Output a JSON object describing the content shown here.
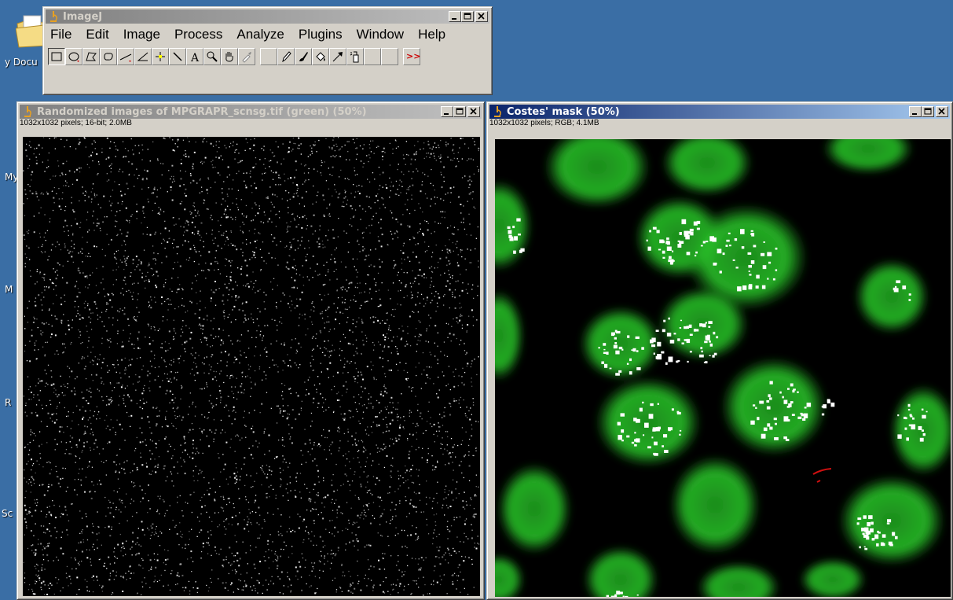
{
  "desktop": {
    "labels": [
      "y Docu",
      "My",
      "M",
      "R",
      "Sc"
    ]
  },
  "imagej": {
    "title": "ImageJ",
    "menu": [
      "File",
      "Edit",
      "Image",
      "Process",
      "Analyze",
      "Plugins",
      "Window",
      "Help"
    ],
    "tools": [
      {
        "name": "rectangle-tool",
        "pressed": true
      },
      {
        "name": "oval-tool"
      },
      {
        "name": "polygon-tool"
      },
      {
        "name": "freehand-tool"
      },
      {
        "name": "line-tool"
      },
      {
        "name": "angle-tool"
      },
      {
        "name": "point-tool"
      },
      {
        "name": "wand-tool"
      },
      {
        "name": "text-tool"
      },
      {
        "name": "magnifier-tool"
      },
      {
        "name": "hand-tool"
      },
      {
        "name": "color-picker-tool"
      },
      {
        "name": "blank-tool"
      },
      {
        "name": "pencil-tool"
      },
      {
        "name": "brush-tool"
      },
      {
        "name": "flood-fill-tool"
      },
      {
        "name": "arrow-tool"
      },
      {
        "name": "spray-tool"
      },
      {
        "name": "blank-tool-2"
      },
      {
        "name": "blank-tool-3"
      },
      {
        "name": "more-tools"
      }
    ],
    "more_label": ">>"
  },
  "window_random": {
    "title": "Randomized images of MPGRAPR_scnsg.tif (green) (50%)",
    "info": "1032x1032 pixels; 16-bit; 2.0MB",
    "active": false
  },
  "window_costes": {
    "title": "Costes' mask (50%)",
    "info": "1032x1032 pixels; RGB; 4.1MB",
    "active": true
  },
  "colors": {
    "desktop": "#3a6ea5",
    "active_title": "#0a246a",
    "mask_green": "#22c322",
    "mask_white": "#ffffff"
  }
}
